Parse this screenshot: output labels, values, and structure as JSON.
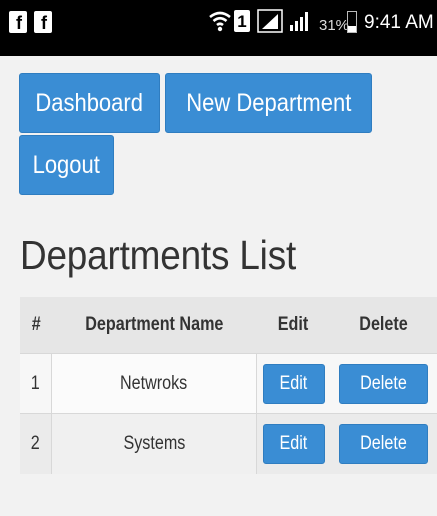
{
  "status_bar": {
    "left_icons": [
      "facebook-icon",
      "facebook-icon"
    ],
    "right_icons": [
      "wifi-icon",
      "sim-icon",
      "signal-icon",
      "signal-icon",
      "battery-icon"
    ],
    "sim_label": "1",
    "battery_percent": "31%",
    "battery_level": 0.31,
    "time": "9:41 AM"
  },
  "nav": {
    "dashboard_label": "Dashboard",
    "new_department_label": "New Department",
    "logout_label": "Logout"
  },
  "page": {
    "title": "Departments List"
  },
  "table": {
    "headers": {
      "index": "#",
      "name": "Department Name",
      "edit": "Edit",
      "delete": "Delete"
    },
    "rows": [
      {
        "index": "1",
        "name": "Netwroks",
        "edit_label": "Edit",
        "delete_label": "Delete"
      },
      {
        "index": "2",
        "name": "Systems",
        "edit_label": "Edit",
        "delete_label": "Delete"
      }
    ]
  },
  "colors": {
    "primary_button": "#3a8dd4",
    "status_bar": "#000000",
    "page_background": "#f2f2f2"
  }
}
